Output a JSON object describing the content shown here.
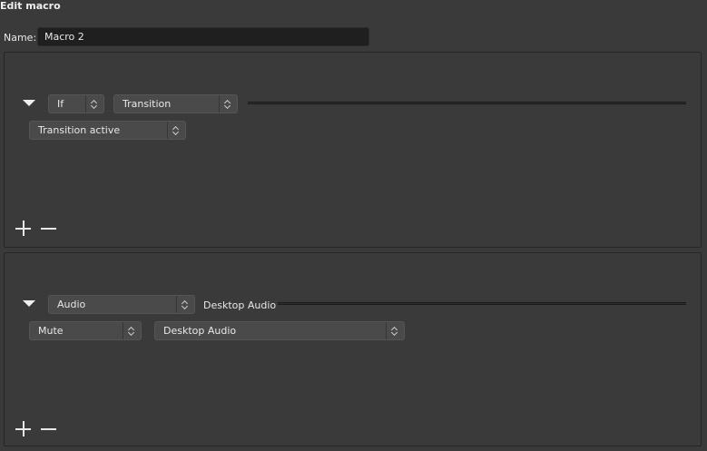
{
  "window": {
    "title": "Edit macro"
  },
  "name_field": {
    "label": "Name:",
    "value": "Macro 2"
  },
  "condition": {
    "logic": "If",
    "type": "Transition",
    "option": "Transition active"
  },
  "action": {
    "type": "Audio",
    "source_header": "Desktop Audio",
    "operation": "Mute",
    "source": "Desktop Audio"
  }
}
